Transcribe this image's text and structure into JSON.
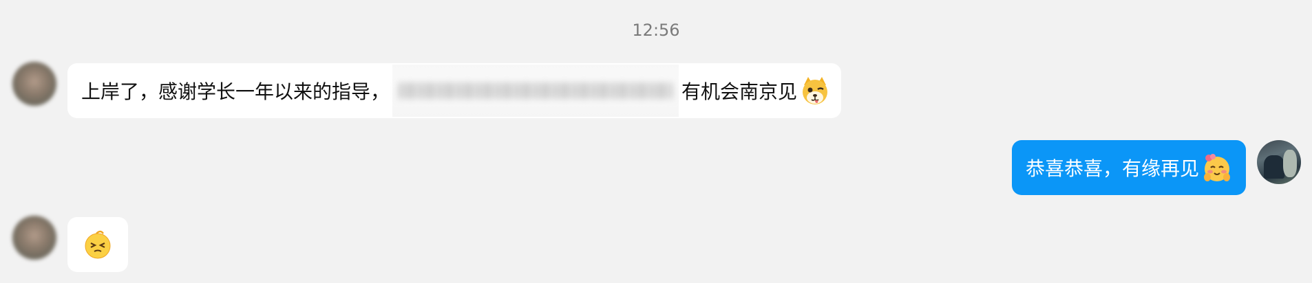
{
  "timestamp": "12:56",
  "messages": [
    {
      "side": "left",
      "pre_text": "上岸了，感谢学长一年以来的指导，",
      "redacted": true,
      "post_text": "有机会南京见",
      "emoji": "dog-face-emoji"
    },
    {
      "side": "right",
      "text": "恭喜恭喜，有缘再见",
      "emoji": "blushing-face-emoji"
    },
    {
      "side": "left",
      "emoji": "squinting-face-emoji"
    }
  ],
  "colors": {
    "background": "#f2f2f2",
    "bubble_left": "#ffffff",
    "bubble_right": "#0b96f7"
  }
}
